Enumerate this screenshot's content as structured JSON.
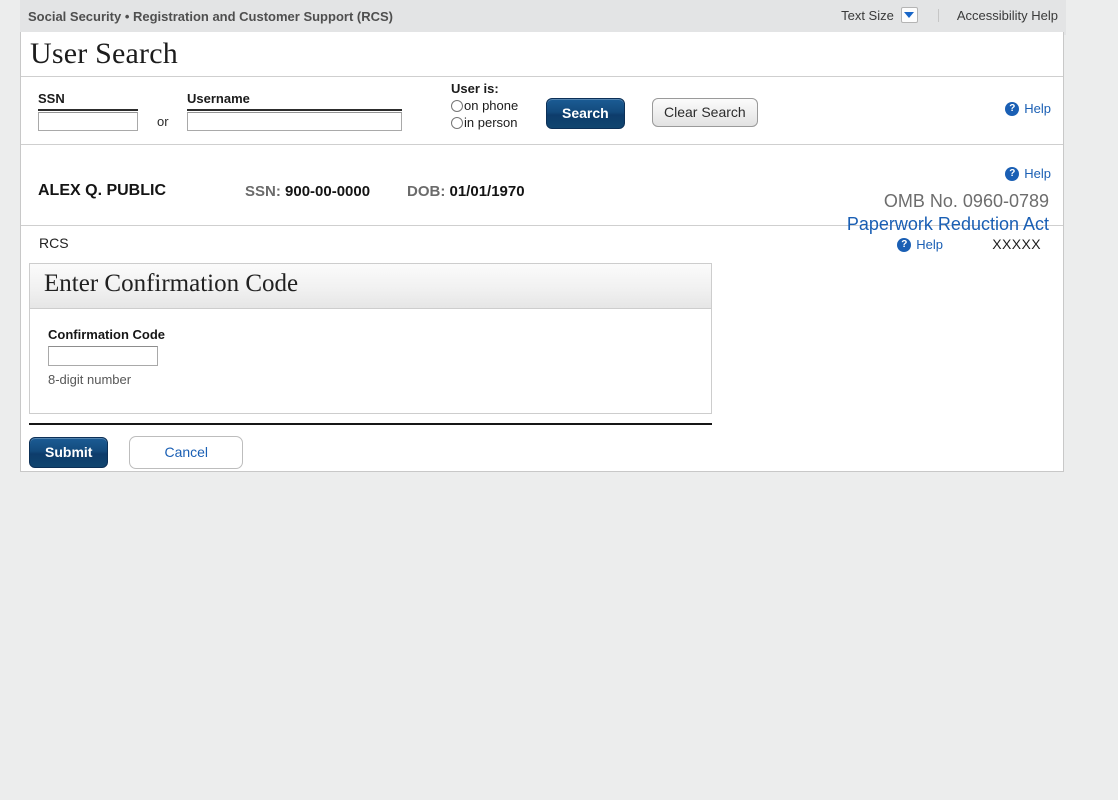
{
  "topbar": {
    "agency_title": "Social Security • Registration and Customer Support (RCS)",
    "text_size_label": "Text Size",
    "text_size_icon": "chevron-down-icon",
    "accessibility_help": "Accessibility Help"
  },
  "page": {
    "title": "User Search"
  },
  "search": {
    "ssn_label": "SSN",
    "ssn_value": "",
    "ssn_placeholder": "",
    "or_text": "or",
    "username_label": "Username",
    "username_value": "",
    "username_placeholder": "",
    "user_is_label": "User is:",
    "radio_on_phone": "on phone",
    "radio_in_person": "in person",
    "radio_selected": "",
    "search_button": "Search",
    "clear_button": "Clear Search",
    "help_label": "Help",
    "help_icon": "question-mark-icon"
  },
  "user": {
    "name": "ALEX Q. PUBLIC",
    "ssn_key": "SSN:",
    "ssn_value": "900-00-0000",
    "dob_key": "DOB:",
    "dob_value": "01/01/1970",
    "help_label": "Help",
    "omb_number": "OMB No. 0960-0789",
    "paperwork_link": "Paperwork Reduction Act"
  },
  "rcs": {
    "label": "RCS",
    "help_label": "Help",
    "code": "XXXXX"
  },
  "panel": {
    "heading": "Enter Confirmation Code",
    "field_label": "Confirmation Code",
    "field_value": "",
    "field_placeholder": "",
    "hint": "8-digit number"
  },
  "actions": {
    "submit": "Submit",
    "cancel": "Cancel"
  },
  "colors": {
    "accent_blue": "#1a5fb4",
    "button_blue": "#134a7c",
    "page_background": "#eceded",
    "topbar_background": "#e3e4e5",
    "panel_border": "#cdcdcd"
  }
}
